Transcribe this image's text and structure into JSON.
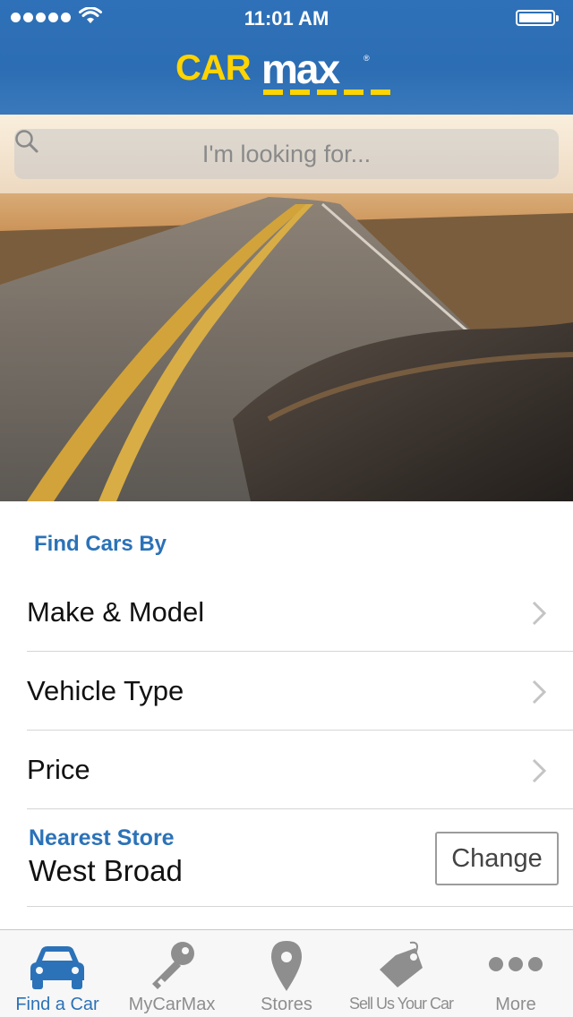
{
  "status_bar": {
    "time": "11:01 AM"
  },
  "header": {
    "logo_car": "CAR",
    "logo_max": "max",
    "logo_reg": "®"
  },
  "search": {
    "placeholder": "I'm looking for..."
  },
  "find_cars": {
    "title": "Find Cars By",
    "items": [
      {
        "label": "Make & Model"
      },
      {
        "label": "Vehicle Type"
      },
      {
        "label": "Price"
      }
    ]
  },
  "nearest_store": {
    "label": "Nearest Store",
    "name": "West Broad",
    "change_label": "Change"
  },
  "tabs": [
    {
      "label": "Find a Car",
      "icon": "car-icon",
      "active": true
    },
    {
      "label": "MyCarMax",
      "icon": "key-icon"
    },
    {
      "label": "Stores",
      "icon": "location-pin-icon"
    },
    {
      "label": "Sell Us Your Car",
      "icon": "price-tag-icon"
    },
    {
      "label": "More",
      "icon": "more-dots-icon"
    }
  ],
  "colors": {
    "brand_blue": "#2c6db3",
    "brand_yellow": "#ffd400",
    "accent_blue": "#2b72b8"
  }
}
